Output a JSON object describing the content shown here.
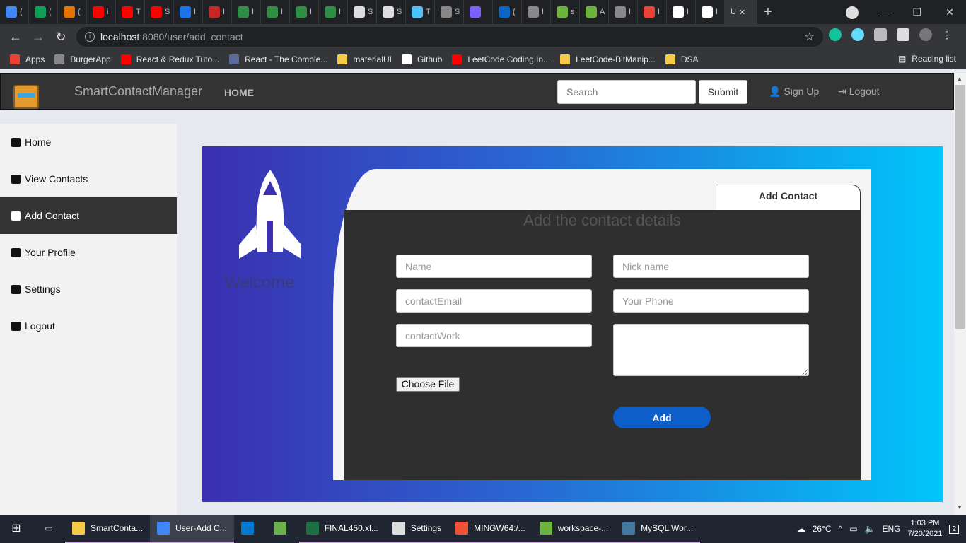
{
  "browser": {
    "tabs": [
      {
        "icon": "docs-icon",
        "label": "(",
        "color": "#4285f4"
      },
      {
        "icon": "sheets-icon",
        "label": "(",
        "color": "#0f9d58"
      },
      {
        "icon": "zigzag-icon",
        "label": "(",
        "color": "#e37400"
      },
      {
        "icon": "youtube-icon",
        "label": "i",
        "color": "#ff0000"
      },
      {
        "icon": "youtube-icon",
        "label": "T",
        "color": "#ff0000"
      },
      {
        "icon": "youtube-icon",
        "label": "S",
        "color": "#ff0000"
      },
      {
        "icon": "info-icon",
        "label": "I",
        "color": "#1a73e8"
      },
      {
        "icon": "shield-icon",
        "label": "I",
        "color": "#c62828"
      },
      {
        "icon": "gfg-icon",
        "label": "I",
        "color": "#2f8d46"
      },
      {
        "icon": "gfg-icon",
        "label": "I",
        "color": "#2f8d46"
      },
      {
        "icon": "gfg-icon",
        "label": "I",
        "color": "#2f8d46"
      },
      {
        "icon": "gfg-icon",
        "label": "I",
        "color": "#2f8d46"
      },
      {
        "icon": "peace-icon",
        "label": "S",
        "color": "#dddddd"
      },
      {
        "icon": "peace-icon",
        "label": "S",
        "color": "#dddddd"
      },
      {
        "icon": "hex-icon",
        "label": "T",
        "color": "#4fc3f7"
      },
      {
        "icon": "ih-icon",
        "label": "S",
        "color": "#888888"
      },
      {
        "icon": "circle-icon",
        "label": "",
        "color": "#7b61ff"
      },
      {
        "icon": "linkedin-icon",
        "label": "(",
        "color": "#0a66c2"
      },
      {
        "icon": "globe-icon",
        "label": "I",
        "color": "#888888"
      },
      {
        "icon": "spring-icon",
        "label": "s",
        "color": "#6db33f"
      },
      {
        "icon": "spring-icon",
        "label": "A",
        "color": "#6db33f"
      },
      {
        "icon": "globe-icon",
        "label": "I",
        "color": "#888888"
      },
      {
        "icon": "gmail-icon",
        "label": "I",
        "color": "#ea4335"
      },
      {
        "icon": "github-icon",
        "label": "I",
        "color": "#ffffff"
      },
      {
        "icon": "github-icon",
        "label": "I",
        "color": "#ffffff"
      }
    ],
    "active_tab_label": "U",
    "url_host": "localhost",
    "url_path": ":8080/user/add_contact",
    "bookmarks": [
      {
        "label": "Apps",
        "color": "#ea4335"
      },
      {
        "label": "BurgerApp",
        "color": "#888888"
      },
      {
        "label": "React & Redux Tuto...",
        "color": "#ff0000"
      },
      {
        "label": "React - The Comple...",
        "color": "#5b6b9a"
      },
      {
        "label": "materialUI",
        "color": "#f7c948"
      },
      {
        "label": "Github",
        "color": "#ffffff"
      },
      {
        "label": "LeetCode Coding In...",
        "color": "#ff0000"
      },
      {
        "label": "LeetCode-BitManip...",
        "color": "#f7c948"
      },
      {
        "label": "DSA",
        "color": "#f7c948"
      }
    ],
    "reading_list": "Reading list"
  },
  "navbar": {
    "brand": "SmartContactManager",
    "home": "HOME",
    "search_placeholder": "Search",
    "submit": "Submit",
    "signup": "Sign Up",
    "logout": "Logout"
  },
  "sidebar": {
    "items": [
      {
        "label": "Home",
        "icon": "home-icon",
        "active": false
      },
      {
        "label": "View Contacts",
        "icon": "address-book-icon",
        "active": false
      },
      {
        "label": "Add Contact",
        "icon": "id-card-icon",
        "active": true
      },
      {
        "label": "Your Profile",
        "icon": "user-icon",
        "active": false
      },
      {
        "label": "Settings",
        "icon": "user-gear-icon",
        "active": false
      },
      {
        "label": "Logout",
        "icon": "sign-out-icon",
        "active": false
      }
    ]
  },
  "main": {
    "welcome": "Welcome",
    "tab_label": "Add Contact",
    "form_title": "Add the contact details",
    "fields": {
      "name": "Name",
      "nickname": "Nick name",
      "email": "contactEmail",
      "phone": "Your Phone",
      "work": "contactWork"
    },
    "choose_file": "Choose File",
    "add": "Add"
  },
  "taskbar": {
    "items": [
      {
        "label": "SmartConta...",
        "icon": "folder-icon",
        "color": "#f7c948",
        "state": "open"
      },
      {
        "label": "User-Add C...",
        "icon": "chrome-icon",
        "color": "#4285f4",
        "state": "active"
      },
      {
        "label": "",
        "icon": "vscode-icon",
        "color": "#0078d4",
        "state": "none"
      },
      {
        "label": "",
        "icon": "notepad-icon",
        "color": "#6ab04c",
        "state": "none"
      },
      {
        "label": "FINAL450.xl...",
        "icon": "excel-icon",
        "color": "#1d6f42",
        "state": "open"
      },
      {
        "label": "Settings",
        "icon": "gear-icon",
        "color": "#dddddd",
        "state": "open"
      },
      {
        "label": "MINGW64:/...",
        "icon": "git-icon",
        "color": "#f05033",
        "state": "open"
      },
      {
        "label": "workspace-...",
        "icon": "spring-icon",
        "color": "#6db33f",
        "state": "open"
      },
      {
        "label": "MySQL Wor...",
        "icon": "mysql-icon",
        "color": "#4479a1",
        "state": "open"
      }
    ],
    "temperature": "26°C",
    "language": "ENG",
    "time": "1:03 PM",
    "date": "7/20/2021",
    "notifications": "2"
  }
}
